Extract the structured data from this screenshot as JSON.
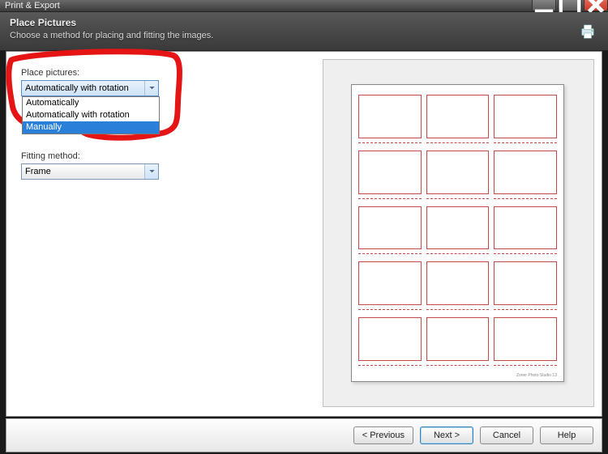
{
  "window": {
    "title": "Print & Export"
  },
  "header": {
    "title": "Place Pictures",
    "subtitle": "Choose a method for placing and fitting the images."
  },
  "left": {
    "place_label": "Place pictures:",
    "place_value": "Automatically with rotation",
    "place_options": [
      "Automatically",
      "Automatically with rotation",
      "Manually"
    ],
    "place_highlight_index": 2,
    "fitting_label": "Fitting method:",
    "fitting_value": "Frame"
  },
  "preview": {
    "rows": 5,
    "cols": 3,
    "credit": "Zoner Photo Studio 13"
  },
  "footer": {
    "previous": "< Previous",
    "next": "Next >",
    "cancel": "Cancel",
    "help": "Help"
  }
}
